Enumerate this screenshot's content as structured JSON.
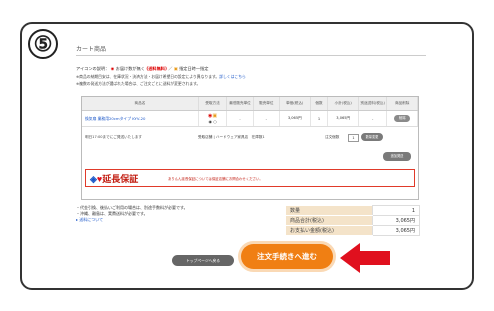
{
  "step": {
    "number": "⑤"
  },
  "section": {
    "title": "カート商品"
  },
  "legend": {
    "prefix": "アイコンの説明：",
    "free_text": "お届け数が無く",
    "free_label": "(送料無料)",
    "after_free": "／",
    "designated_text": "指定日時一指定"
  },
  "notes": {
    "line1": "※商品の納期目安は、在庫状況・決済方法・お届け希望日の設定により異なります。",
    "line1_link": "詳しくはこちら",
    "line2": "※複数の発送方法が選ばれた場合は、ご注文ごとに送料が変更されます。"
  },
  "cart": {
    "headers": [
      "商品名",
      "受取方法",
      "最低販売単位",
      "販売単位",
      "単価(税込)",
      "個数",
      "小計(税込)",
      "別途送料(税込)",
      "商品削除"
    ],
    "rows": [
      {
        "name": "換気扇 業務用20cmタイプ KYV-20",
        "min_unit": "-",
        "unit": "-",
        "price": "3,065円",
        "qty": "1",
        "subtotal": "3,065円",
        "shipping": "-",
        "delete": "削除"
      }
    ],
    "shipping_note": "明日17:00までにご発送いたします",
    "shipping_method": "受取店舗 | ハードウェア家具店",
    "stock_label": "在庫数1",
    "qty_label": "注文個数",
    "qty_value": "1",
    "change_btn": "数量変更",
    "repeat_btn": "追加発送",
    "banner_title": "延長保証",
    "banner_sub": "ありんん延長保証については保証店舗にお問合わせください。"
  },
  "lower_notes": {
    "line1": "・代金引換、後払いご利用の場合は、別途手数料が必要です。",
    "line2": "・沖縄、離島は、実費送料が必要です。",
    "link": "▸ 送料について"
  },
  "summary": [
    {
      "label": "数量",
      "value": "1"
    },
    {
      "label": "商品合計(税込)",
      "value": "3,065円"
    },
    {
      "label": "お支払い金額(税込)",
      "value": "3,065円"
    }
  ],
  "buttons": {
    "top": "トップページへ戻る",
    "checkout": "注文手続きへ進む"
  },
  "colors": {
    "accent": "#f07f13",
    "arrow": "#e0101e",
    "banner": "#c21e12"
  }
}
